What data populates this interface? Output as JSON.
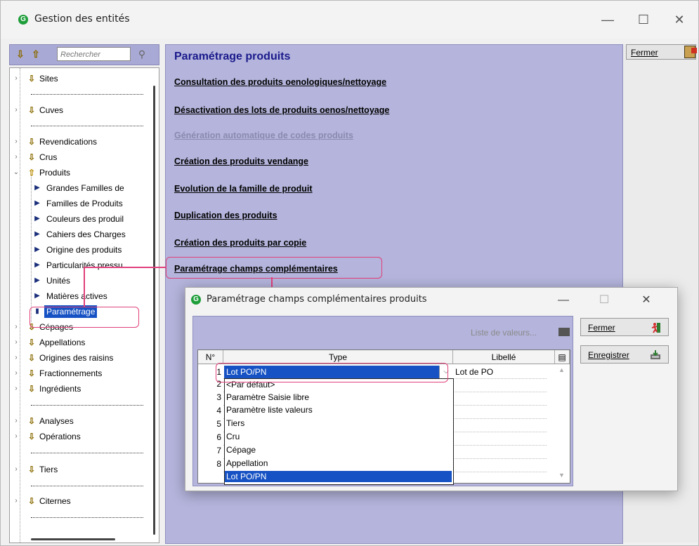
{
  "window": {
    "title": "Gestion des entités"
  },
  "search": {
    "placeholder": "Rechercher"
  },
  "tree": {
    "items": [
      {
        "label": "Sites"
      },
      {
        "label": "Cuves"
      },
      {
        "label": "Revendications"
      },
      {
        "label": "Crus"
      },
      {
        "label": "Produits"
      },
      {
        "label": "Grandes Familles de"
      },
      {
        "label": "Familles de Produits"
      },
      {
        "label": "Couleurs des produil"
      },
      {
        "label": "Cahiers des Charges"
      },
      {
        "label": "Origine des produits"
      },
      {
        "label": "Particularités pressu"
      },
      {
        "label": "Unités"
      },
      {
        "label": "Matières actives"
      },
      {
        "label": "Paramétrage"
      },
      {
        "label": "Cépages"
      },
      {
        "label": "Appellations"
      },
      {
        "label": "Origines des raisins"
      },
      {
        "label": "Fractionnements"
      },
      {
        "label": "Ingrédients"
      },
      {
        "label": "Analyses"
      },
      {
        "label": "Opérations"
      },
      {
        "label": "Tiers"
      },
      {
        "label": "Citernes"
      }
    ]
  },
  "main": {
    "title": "Paramétrage produits",
    "links": [
      {
        "label": "Consultation des produits oenologiques/nettoyage"
      },
      {
        "label": "Désactivation des lots de produits oenos/nettoyage"
      },
      {
        "label": "Génération automatique de codes produits"
      },
      {
        "label": "Création des produits vendange"
      },
      {
        "label": "Evolution de la famille de produit"
      },
      {
        "label": "Duplication des produits"
      },
      {
        "label": "Création des produits par copie"
      },
      {
        "label": "Paramétrage champs complémentaires"
      }
    ]
  },
  "right": {
    "close_label": "Fermer"
  },
  "dialog": {
    "title": "Paramétrage champs complémentaires produits",
    "list_values_label": "Liste de valeurs...",
    "columns": {
      "num": "N°",
      "type": "Type",
      "label": "Libellé"
    },
    "rows": [
      "1",
      "2",
      "3",
      "4",
      "5",
      "6",
      "7",
      "8"
    ],
    "current_type": "Lot PO/PN",
    "current_label": "Lot de PO",
    "options": [
      "<Par défaut>",
      "Paramètre Saisie libre",
      "Paramètre liste valeurs",
      "Tiers",
      "Cru",
      "Cépage",
      "Appellation",
      "Lot PO/PN"
    ],
    "close_label": "Fermer",
    "save_label": "Enregistrer"
  }
}
